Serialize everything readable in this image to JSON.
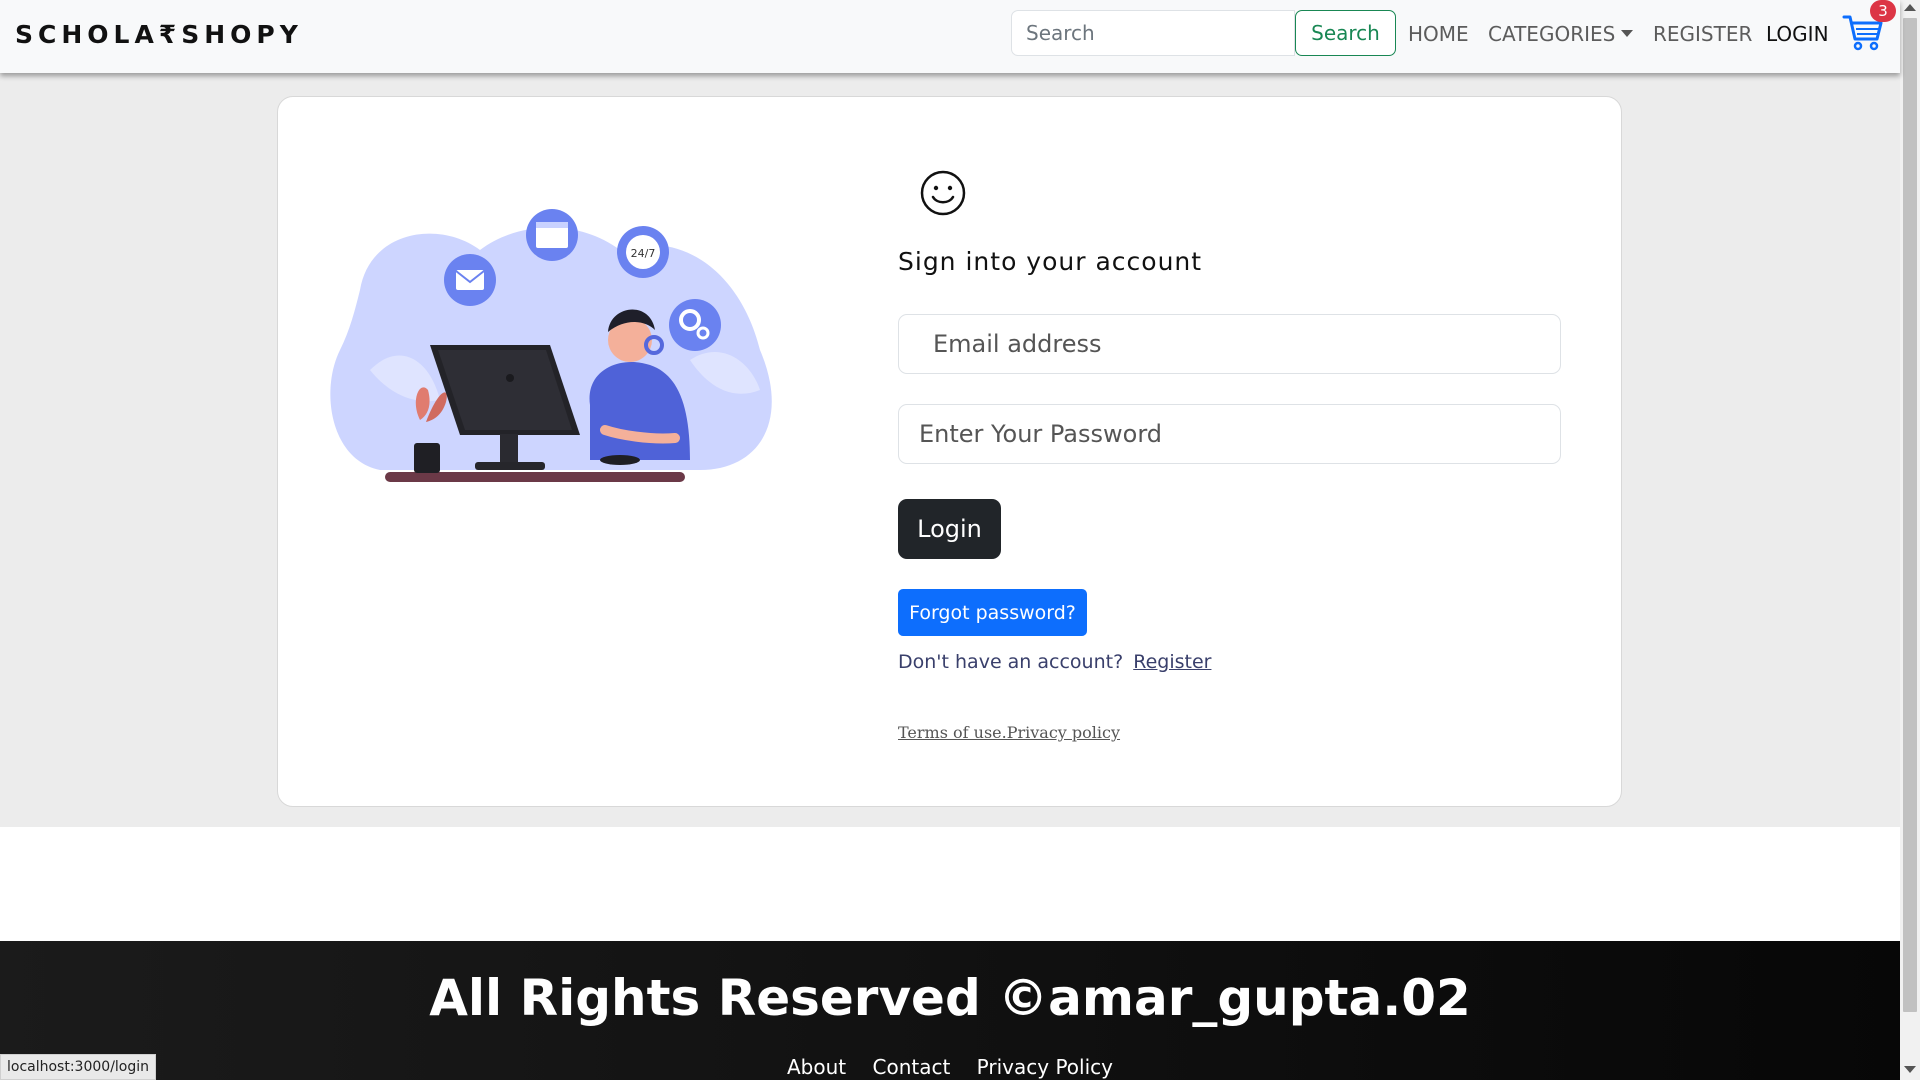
{
  "brand": "SCHOLA₹SHOPY",
  "search": {
    "placeholder": "Search",
    "button_label": "Search"
  },
  "nav": {
    "home": "HOME",
    "categories": "CATEGORIES",
    "register": "REGISTER",
    "login": "LOGIN",
    "cart_count": "3"
  },
  "login_form": {
    "title": "Sign into your account",
    "email_placeholder": "Email address",
    "password_placeholder": "Enter Your Password",
    "login_button": "Login",
    "forgot_button": "Forgot password?",
    "no_account_text": "Don't have an account?",
    "register_link": "Register",
    "terms_text": "Terms of use.Privacy policy"
  },
  "footer": {
    "title": "All Rights Reserved ©amar_gupta.02",
    "links": [
      "About",
      "Contact",
      "Privacy Policy"
    ]
  },
  "status_bar": {
    "url": "localhost:3000/login"
  },
  "colors": {
    "search_green": "#198754",
    "login_dark": "#212529",
    "forgot_blue": "#0d6efd",
    "badge_red": "#dc3545",
    "cart_blue": "#0d6efd"
  },
  "icons": {
    "cart": "cart-icon",
    "smile": "smile-icon",
    "dropdown": "chevron-down-icon"
  }
}
